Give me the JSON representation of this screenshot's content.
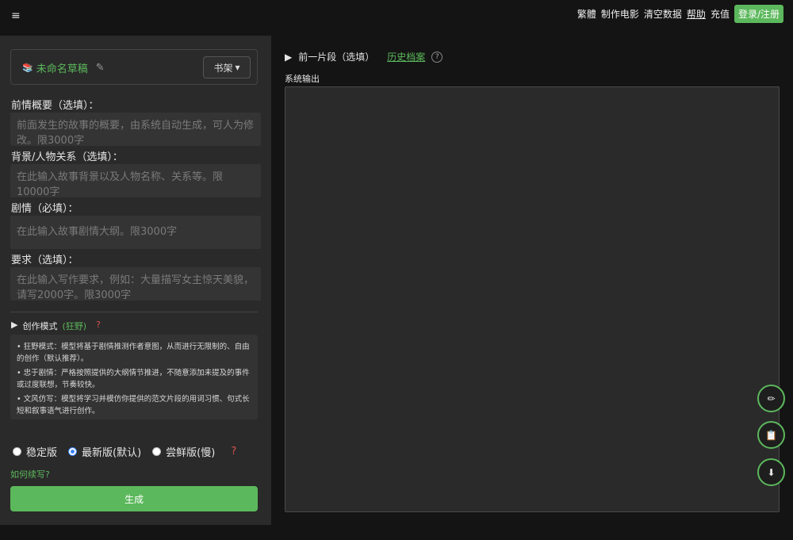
{
  "topbar": {
    "menu_icon": "≡",
    "nav": [
      "繁體",
      "制作电影",
      "清空数据"
    ],
    "help": "帮助",
    "recharge": "充值",
    "login": "登录/注册"
  },
  "draft": {
    "icon": "book-stack-icon",
    "title": "未命名草稿",
    "edit_icon": "✎",
    "shelf_button": "书架",
    "shelf_caret": "▾"
  },
  "fields": {
    "summary": {
      "label": "前情概要（选填）：",
      "placeholder": "前面发生的故事的概要，由系统自动生成，可人为修改。限3000字"
    },
    "background": {
      "label": "背景/人物关系（选填）：",
      "placeholder": "在此输入故事背景以及人物名称、关系等。限10000字"
    },
    "plot": {
      "label": "剧情（必填）：",
      "placeholder": "在此输入故事剧情大纲。限3000字"
    },
    "requirements": {
      "label": "要求（选填）：",
      "placeholder": "在此输入写作要求，例如：大量描写女主惊天美貌，请写2000字。限3000字"
    }
  },
  "mode": {
    "arrow": "▶",
    "label": "创作模式",
    "value": "(狂野)",
    "help": "?",
    "descriptions": [
      "• 狂野模式：模型将基于剧情推测作者意图，从而进行无限制的、自由的创作（默认推荐）。",
      "• 忠于剧情：严格按照提供的大纲情节推进，不随意添加未提及的事件或过度联想，节奏较快。",
      "• 文风仿写：模型将学习并模仿你提供的范文片段的用词习惯、句式长短和叙事语气进行创作。"
    ]
  },
  "versions": {
    "options": [
      "稳定版",
      "最新版(默认)",
      "尝鲜版(慢)"
    ],
    "selected": "最新版(默认)",
    "help": "?"
  },
  "howto": "如何续写?",
  "generate": "生成",
  "right": {
    "prev_arrow": "▶",
    "prev_label": "前一片段（选填）",
    "history": "历史档案",
    "history_help": "?",
    "output_label": "系统输出"
  },
  "fabs": [
    {
      "name": "pencil-icon",
      "glyph": "✏"
    },
    {
      "name": "clipboard-icon",
      "glyph": "📋"
    },
    {
      "name": "download-icon",
      "glyph": "⬇"
    }
  ],
  "colors": {
    "accent": "#5cb85c",
    "warn": "#d9534f",
    "panel": "#2a2a2a",
    "bg": "#141414"
  }
}
